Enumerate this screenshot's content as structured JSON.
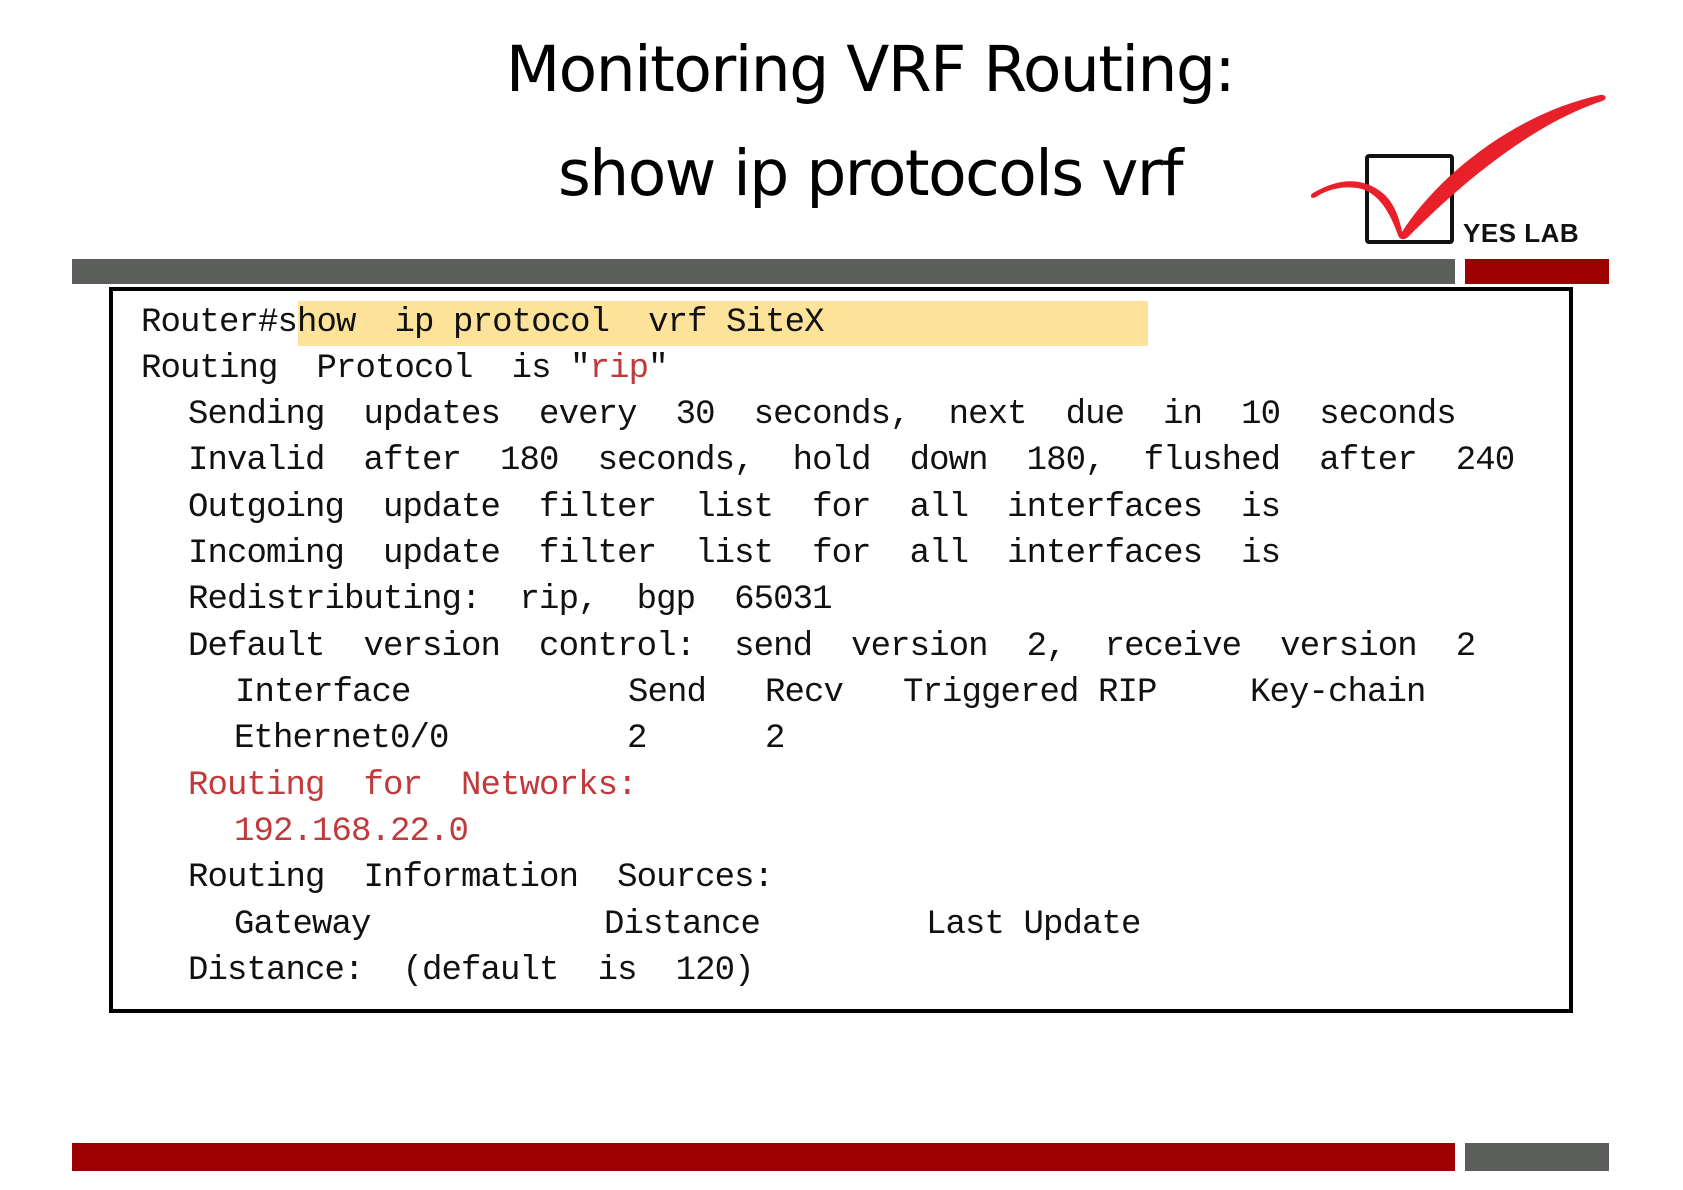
{
  "slide": {
    "title_line1": "Monitoring VRF Routing:",
    "title_line2": "show ip protocols vrf",
    "logo": {
      "icon": "checkmark-box-icon",
      "text": "YES LAB",
      "check_color": "#e8202a"
    },
    "colors": {
      "accent_red": "#9c0000",
      "bar_gray": "#5c5e5b",
      "highlight": "#fde39a",
      "output_red": "#c0393b"
    }
  },
  "terminal": {
    "prompt": "Router#",
    "command": "show  ip protocol  vrf SiteX",
    "protocol_line_prefix": "Routing  Protocol  is \"",
    "protocol_name": "rip",
    "protocol_line_suffix": "\"",
    "lines": [
      "Sending  updates  every  30  seconds,  next  due  in  10  seconds",
      "Invalid  after  180  seconds,  hold  down  180,  flushed  after  240",
      "Outgoing  update  filter  list  for  all  interfaces  is",
      "Incoming  update  filter  list  for  all  interfaces  is",
      "Redistributing:  rip,  bgp  65031",
      "Default  version  control:  send  version  2,  receive  version  2"
    ],
    "interface_table": {
      "headers": [
        "Interface",
        "Send",
        "Recv",
        "Triggered RIP",
        "Key-chain"
      ],
      "rows": [
        {
          "interface": "Ethernet0/0",
          "send": "2",
          "recv": "2",
          "triggered_rip": "",
          "key_chain": ""
        }
      ]
    },
    "routing_for_networks_label": "Routing  for  Networks:",
    "networks": [
      "192.168.22.0"
    ],
    "info_sources_label": "Routing  Information  Sources:",
    "sources_table": {
      "headers": [
        "Gateway",
        "Distance",
        "Last Update"
      ],
      "rows": []
    },
    "distance_line": "Distance:  (default  is  120)"
  }
}
